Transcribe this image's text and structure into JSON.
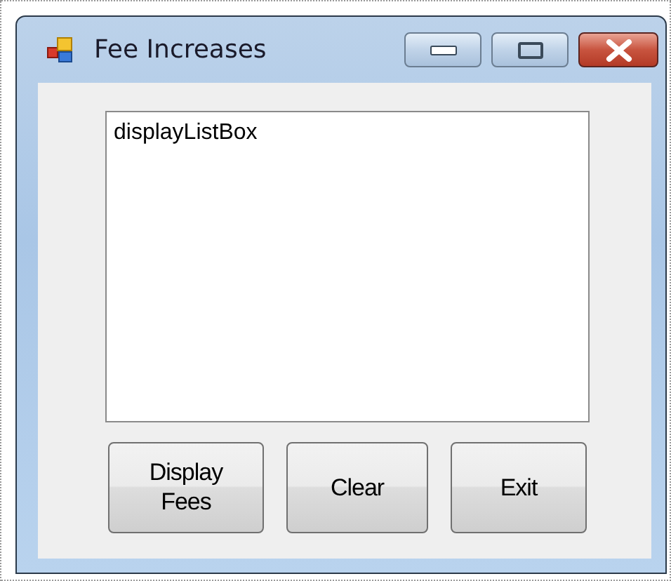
{
  "window": {
    "title": "Fee Increases"
  },
  "list_box": {
    "items": [
      "displayListBox"
    ]
  },
  "buttons": [
    {
      "label": "Display Fees"
    },
    {
      "label": "Clear"
    },
    {
      "label": "Exit"
    }
  ]
}
